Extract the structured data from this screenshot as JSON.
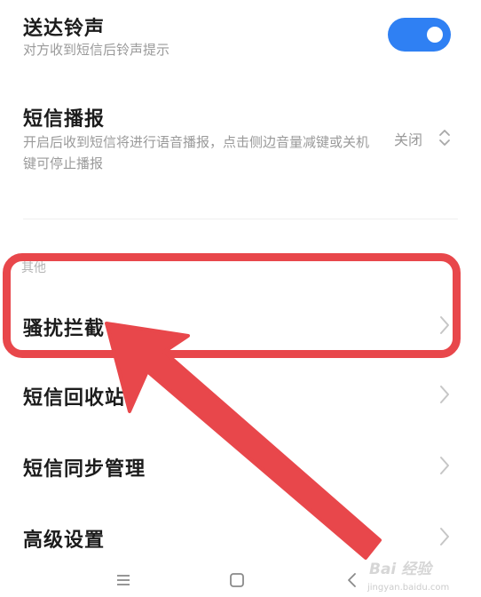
{
  "settings": {
    "delivery_ringtone": {
      "title": "送达铃声",
      "desc": "对方收到短信后铃声提示",
      "enabled": true
    },
    "sms_broadcast": {
      "title": "短信播报",
      "desc": "开启后收到短信将进行语音播报，点击侧边音量减键或关机键可停止播报",
      "value": "关闭"
    },
    "other_section": {
      "header": "其他",
      "items": [
        {
          "label": "骚扰拦截"
        },
        {
          "label": "短信回收站"
        },
        {
          "label": "短信同步管理"
        },
        {
          "label": "高级设置"
        }
      ]
    }
  },
  "watermark": {
    "text": "Bai 经验",
    "url": "jingyan.baidu.com"
  },
  "colors": {
    "accent": "#2f80f3",
    "annotation": "#e8474b"
  },
  "icons": {
    "nav": [
      "menu-icon",
      "home-icon",
      "back-icon"
    ]
  }
}
